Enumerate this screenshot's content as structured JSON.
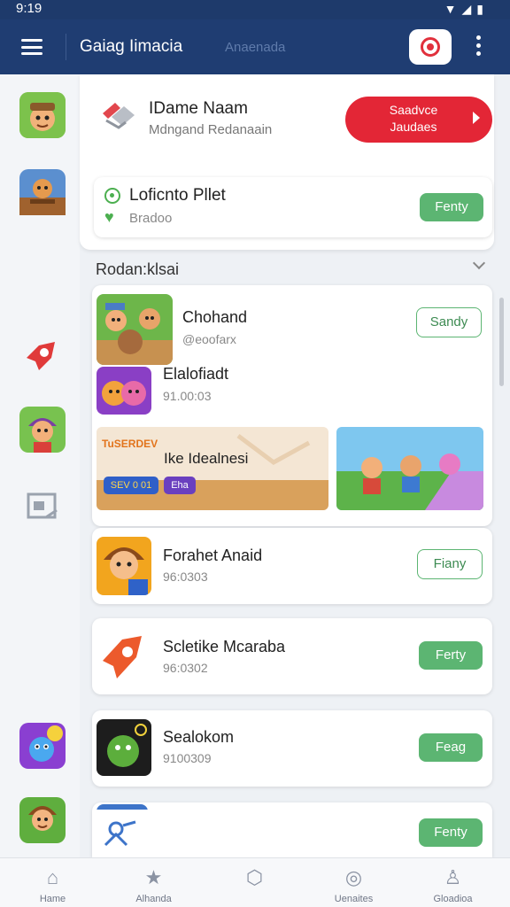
{
  "status_bar": {
    "time": "9:19"
  },
  "app_bar": {
    "title": "Gaiag Iimacia",
    "subtitle": "Anaenada"
  },
  "profile": {
    "name": "IDame Naam",
    "subtitle": "Mdngand Redanaain",
    "cta_line1": "Saadvce",
    "cta_line2": "Jaudaes"
  },
  "featured": {
    "title": "Loficnto Pllet",
    "subtitle": "Bradoo",
    "button": "Fenty"
  },
  "section": {
    "title": "Rodan:klsai"
  },
  "items": [
    {
      "title": "Chohand",
      "subtitle": "@eoofarx",
      "button": "Sandy"
    },
    {
      "title": "Elalofiadt",
      "subtitle": "91.00:03"
    },
    {
      "title": "Ike Idealnesi",
      "badge_primary": "SEV 0 01",
      "badge_secondary": "Eha",
      "art_text": "TuSERDEV"
    },
    {
      "title": "Forahet Anaid",
      "subtitle": "96:0303",
      "button": "Fiany"
    },
    {
      "title": "Scletike Mcaraba",
      "subtitle": "96:0302",
      "button": "Ferty"
    },
    {
      "title": "Sealokom",
      "subtitle": "9100309",
      "button": "Feag"
    },
    {
      "title": "",
      "subtitle": "",
      "button": "Fenty"
    }
  ],
  "bottom_nav": [
    {
      "label": "Hame",
      "icon": "home-icon"
    },
    {
      "label": "Alhanda",
      "icon": "star-icon"
    },
    {
      "label": "",
      "icon": "shield-icon"
    },
    {
      "label": "Uenaites",
      "icon": "target-icon"
    },
    {
      "label": "Gloadioa",
      "icon": "person-icon"
    }
  ],
  "colors": {
    "appbar": "#1f3d72",
    "accent_red": "#e32636",
    "accent_green": "#5cb572"
  }
}
